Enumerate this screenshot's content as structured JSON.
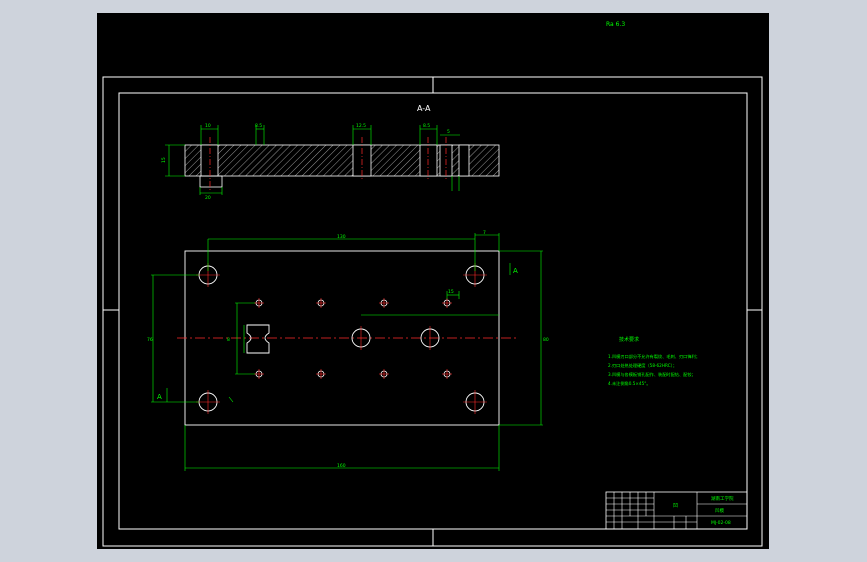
{
  "drawing": {
    "corner_note": "Ra 6.3",
    "section_title": "A-A",
    "section_marker": "A",
    "colors": {
      "background": "#000000",
      "viewer_bg": "#ced3dc",
      "outline": "#ffffff",
      "dimension": "#00ff00",
      "centerline": "#ff2a2a",
      "hatch": "#ffffff"
    }
  },
  "top_view": {
    "dims": {
      "overall_length": "160",
      "hole_pitch": "130",
      "hole_offset": "7",
      "overall_width": "80",
      "inner_width": "76",
      "row_spacing": "8",
      "small_pitch": "15"
    }
  },
  "section_view": {
    "dims": {
      "left_step": "10",
      "bore_1": "8.5",
      "bore_2": "12.5",
      "slot": "5",
      "right_bore": "8.5",
      "height": "15",
      "bottom": "20"
    }
  },
  "notes": {
    "title": "技术要求",
    "lines": [
      "1.凹模刃口部分不允许有裂纹、毛刺、刃口锋利；",
      "2.刃口处热处理硬度（58-62HRC）；",
      "3.凹模与各模板销孔配作、装配时配钻、配铰；",
      "4.未注倒角0.5×45°。"
    ]
  },
  "title_block": {
    "part_name": "凹",
    "school": "湖南工学院",
    "part_label": "凹模",
    "drawing_no": "MJ-02-08"
  }
}
